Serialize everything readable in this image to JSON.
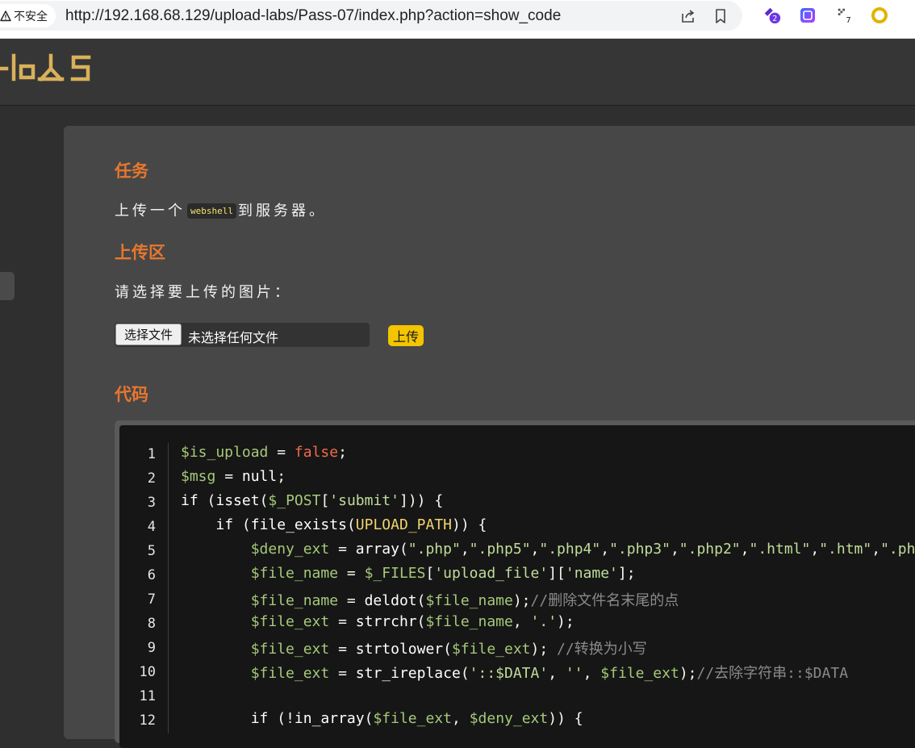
{
  "browser": {
    "security_label": "不安全",
    "url": "http://192.168.68.129/upload-labs/Pass-07/index.php?action=show_code",
    "extensions": [
      {
        "icon": "hexagon-extension-icon",
        "badge": "2"
      },
      {
        "icon": "gradient-square-extension-icon",
        "badge": ""
      },
      {
        "icon": "bug-extension-icon",
        "badge": "7"
      },
      {
        "icon": "yellow-ring-extension-icon",
        "badge": ""
      }
    ]
  },
  "header": {
    "logo_text": "-loLS"
  },
  "task": {
    "heading": "任务",
    "text_before": "上传一个",
    "code_word": "webshell",
    "text_after": "到服务器。"
  },
  "upload": {
    "heading": "上传区",
    "prompt": "请选择要上传的图片：",
    "choose_button": "选择文件",
    "file_status": "未选择任何文件",
    "submit_button": "上传"
  },
  "code": {
    "heading": "代码",
    "lines": [
      {
        "n": "1",
        "tokens": [
          [
            "var",
            "$is_upload"
          ],
          [
            "op",
            " = "
          ],
          [
            "bool",
            "false"
          ],
          [
            "op",
            ";"
          ]
        ]
      },
      {
        "n": "2",
        "tokens": [
          [
            "var",
            "$msg"
          ],
          [
            "op",
            " = "
          ],
          [
            "kw",
            "null"
          ],
          [
            "op",
            ";"
          ]
        ]
      },
      {
        "n": "3",
        "tokens": [
          [
            "kw",
            "if"
          ],
          [
            "op",
            " ("
          ],
          [
            "fn",
            "isset"
          ],
          [
            "op",
            "("
          ],
          [
            "var",
            "$_POST"
          ],
          [
            "op",
            "["
          ],
          [
            "str",
            "'submit'"
          ],
          [
            "op",
            "])) {"
          ]
        ]
      },
      {
        "n": "4",
        "tokens": [
          [
            "op",
            "    "
          ],
          [
            "kw",
            "if"
          ],
          [
            "op",
            " ("
          ],
          [
            "fn",
            "file_exists"
          ],
          [
            "op",
            "("
          ],
          [
            "const",
            "UPLOAD_PATH"
          ],
          [
            "op",
            ")) {"
          ]
        ]
      },
      {
        "n": "5",
        "tokens": [
          [
            "op",
            "        "
          ],
          [
            "var",
            "$deny_ext"
          ],
          [
            "op",
            " = "
          ],
          [
            "fn",
            "array"
          ],
          [
            "op",
            "("
          ],
          [
            "str",
            "\".php\""
          ],
          [
            "op",
            ","
          ],
          [
            "str",
            "\".php5\""
          ],
          [
            "op",
            ","
          ],
          [
            "str",
            "\".php4\""
          ],
          [
            "op",
            ","
          ],
          [
            "str",
            "\".php3\""
          ],
          [
            "op",
            ","
          ],
          [
            "str",
            "\".php2\""
          ],
          [
            "op",
            ","
          ],
          [
            "str",
            "\".html\""
          ],
          [
            "op",
            ","
          ],
          [
            "str",
            "\".htm\""
          ],
          [
            "op",
            ","
          ],
          [
            "str",
            "\".phtml\""
          ]
        ]
      },
      {
        "n": "6",
        "tokens": [
          [
            "op",
            "        "
          ],
          [
            "var",
            "$file_name"
          ],
          [
            "op",
            " = "
          ],
          [
            "var",
            "$_FILES"
          ],
          [
            "op",
            "["
          ],
          [
            "str",
            "'upload_file'"
          ],
          [
            "op",
            "]["
          ],
          [
            "str",
            "'name'"
          ],
          [
            "op",
            "];"
          ]
        ]
      },
      {
        "n": "7",
        "tokens": [
          [
            "op",
            "        "
          ],
          [
            "var",
            "$file_name"
          ],
          [
            "op",
            " = "
          ],
          [
            "fn",
            "deldot"
          ],
          [
            "op",
            "("
          ],
          [
            "var",
            "$file_name"
          ],
          [
            "op",
            ");"
          ],
          [
            "cmt",
            "//删除文件名末尾的点"
          ]
        ]
      },
      {
        "n": "8",
        "tokens": [
          [
            "op",
            "        "
          ],
          [
            "var",
            "$file_ext"
          ],
          [
            "op",
            " = "
          ],
          [
            "fn",
            "strrchr"
          ],
          [
            "op",
            "("
          ],
          [
            "var",
            "$file_name"
          ],
          [
            "op",
            ", "
          ],
          [
            "str",
            "'.'"
          ],
          [
            "op",
            ");"
          ]
        ]
      },
      {
        "n": "9",
        "tokens": [
          [
            "op",
            "        "
          ],
          [
            "var",
            "$file_ext"
          ],
          [
            "op",
            " = "
          ],
          [
            "fn",
            "strtolower"
          ],
          [
            "op",
            "("
          ],
          [
            "var",
            "$file_ext"
          ],
          [
            "op",
            "); "
          ],
          [
            "cmt",
            "//转换为小写"
          ]
        ]
      },
      {
        "n": "10",
        "tokens": [
          [
            "op",
            "        "
          ],
          [
            "var",
            "$file_ext"
          ],
          [
            "op",
            " = "
          ],
          [
            "fn",
            "str_ireplace"
          ],
          [
            "op",
            "("
          ],
          [
            "str",
            "'::$DATA'"
          ],
          [
            "op",
            ", "
          ],
          [
            "str",
            "''"
          ],
          [
            "op",
            ", "
          ],
          [
            "var",
            "$file_ext"
          ],
          [
            "op",
            ");"
          ],
          [
            "cmt",
            "//去除字符串::$DATA"
          ]
        ]
      },
      {
        "n": "11",
        "tokens": []
      },
      {
        "n": "12",
        "tokens": [
          [
            "op",
            "        "
          ],
          [
            "kw",
            "if"
          ],
          [
            "op",
            " (!"
          ],
          [
            "fn",
            "in_array"
          ],
          [
            "op",
            "("
          ],
          [
            "var",
            "$file_ext"
          ],
          [
            "op",
            ", "
          ],
          [
            "var",
            "$deny_ext"
          ],
          [
            "op",
            ")) {"
          ]
        ]
      }
    ]
  }
}
